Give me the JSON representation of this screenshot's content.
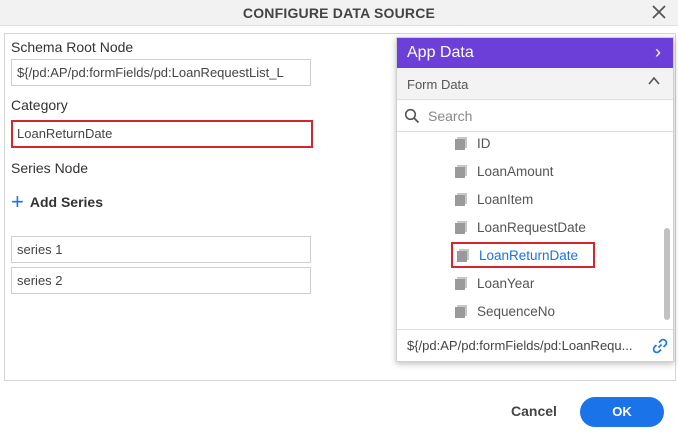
{
  "dialog": {
    "title": "CONFIGURE DATA SOURCE",
    "close_icon": "close-icon"
  },
  "form": {
    "schema_root_label": "Schema Root Node",
    "schema_root_value": "${/pd:AP/pd:formFields/pd:LoanRequestList_L",
    "category_label": "Category",
    "category_value": "LoanReturnDate",
    "series_node_label": "Series Node",
    "add_series_label": "Add Series",
    "series": [
      "series 1",
      "series 2"
    ]
  },
  "panel": {
    "title": "App Data",
    "section": "Form Data",
    "search_placeholder": "Search",
    "items": [
      "ID",
      "LoanAmount",
      "LoanItem",
      "LoanRequestDate",
      "LoanReturnDate",
      "LoanYear",
      "SequenceNo"
    ],
    "selected_item": "LoanReturnDate",
    "footer_path": "${/pd:AP/pd:formFields/pd:LoanRequ..."
  },
  "footer": {
    "cancel_label": "Cancel",
    "ok_label": "OK"
  },
  "colors": {
    "accent": "#1a73e8",
    "panel_header": "#6c3fd8",
    "highlight": "#d6262d"
  }
}
